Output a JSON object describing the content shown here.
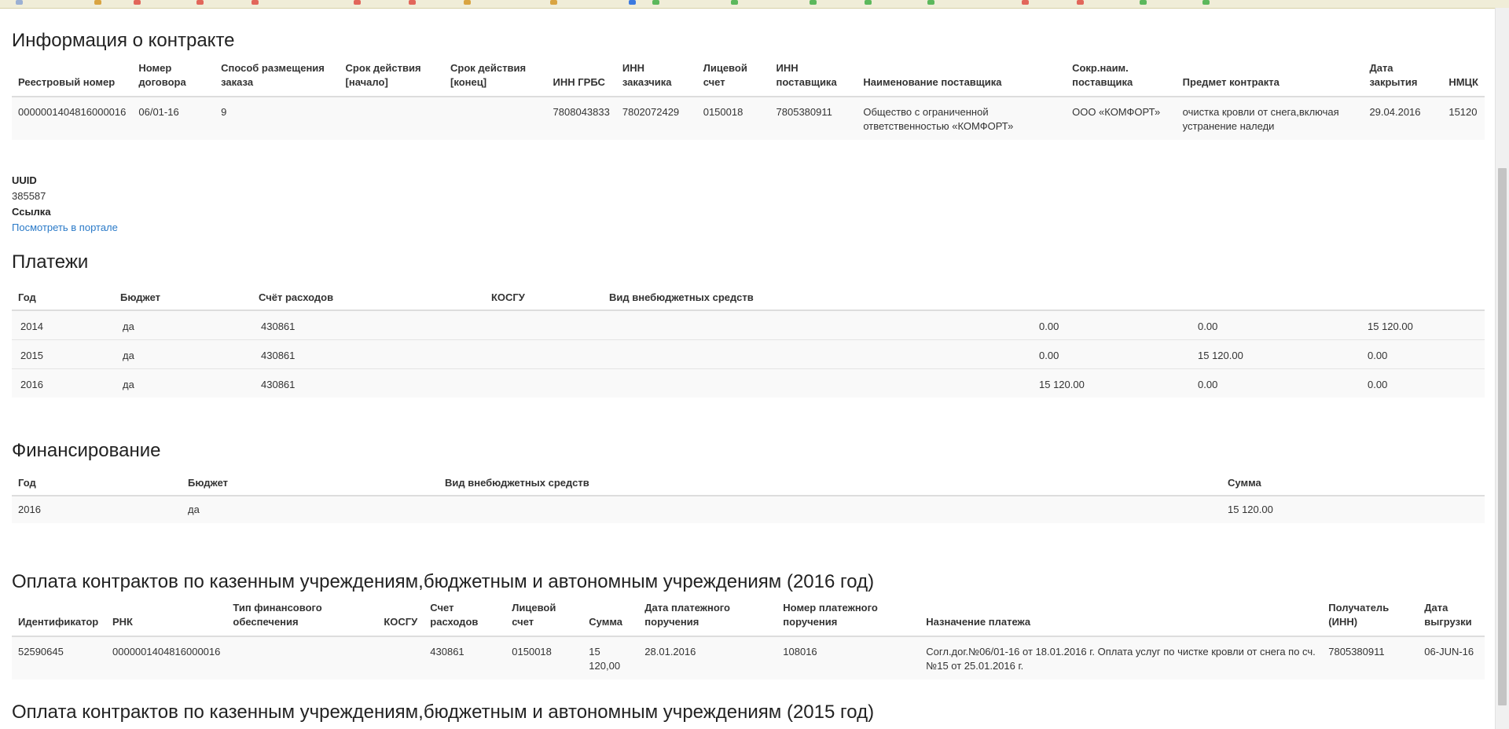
{
  "contract": {
    "title": "Информация о контракте",
    "headers": [
      "Реестровый номер",
      "Номер договора",
      "Способ размещения заказа",
      "Срок действия [начало]",
      "Срок действия [конец]",
      "ИНН ГРБС",
      "ИНН заказчика",
      "Лицевой счет",
      "ИНН поставщика",
      "Наименование поставщика",
      "Сокр.наим. поставщика",
      "Предмет контракта",
      "Дата закрытия",
      "НМЦК"
    ],
    "row": [
      "0000001404816000016",
      "06/01-16",
      "9",
      "",
      "",
      "7808043833",
      "7802072429",
      "0150018",
      "7805380911",
      "Общество с ограниченной ответственностью «КОМФОРТ»",
      "ООО «КОМФОРТ»",
      "очистка кровли от снега,включая устранение наледи",
      "29.04.2016",
      "15120"
    ]
  },
  "meta": {
    "uuid_label": "UUID",
    "uuid_value": "385587",
    "link_label": "Ссылка",
    "link_text": "Посмотреть в портале"
  },
  "payments": {
    "title": "Платежи",
    "headers": [
      "Год",
      "Бюджет",
      "Счёт расходов",
      "КОСГУ",
      "Вид внебюджетных средств",
      "",
      "",
      ""
    ],
    "rows": [
      [
        "2014",
        "да",
        "430861",
        "",
        "",
        "0.00",
        "0.00",
        "15 120.00"
      ],
      [
        "2015",
        "да",
        "430861",
        "",
        "",
        "0.00",
        "15 120.00",
        "0.00"
      ],
      [
        "2016",
        "да",
        "430861",
        "",
        "",
        "15 120.00",
        "0.00",
        "0.00"
      ]
    ]
  },
  "financing": {
    "title": "Финансирование",
    "headers": [
      "Год",
      "Бюджет",
      "Вид внебюджетных средств",
      "Сумма"
    ],
    "row": [
      "2016",
      "да",
      "",
      "15 120.00"
    ]
  },
  "payments2016": {
    "title": "Оплата контрактов по казенным учреждениям,бюджетным и автономным учреждениям (2016 год)",
    "headers": [
      "Идентификатор",
      "РНК",
      "Тип финансового обеспечения",
      "КОСГУ",
      "Счет расходов",
      "Лицевой счет",
      "Сумма",
      "Дата платежного поручения",
      "Номер платежного поручения",
      "Назначение платежа",
      "Получатель (ИНН)",
      "Дата выгрузки"
    ],
    "row": [
      "52590645",
      "0000001404816000016",
      "",
      "",
      "430861",
      "0150018",
      "15 120,00",
      "28.01.2016",
      "108016",
      "Согл.дог.№06/01-16 от 18.01.2016 г. Оплата услуг по чистке кровли от снега по сч.№15 от 25.01.2016 г.",
      "7805380911",
      "06-JUN-16"
    ]
  },
  "payments2015": {
    "title": "Оплата контрактов по казенным учреждениям,бюджетным и автономным учреждениям (2015 год)"
  }
}
